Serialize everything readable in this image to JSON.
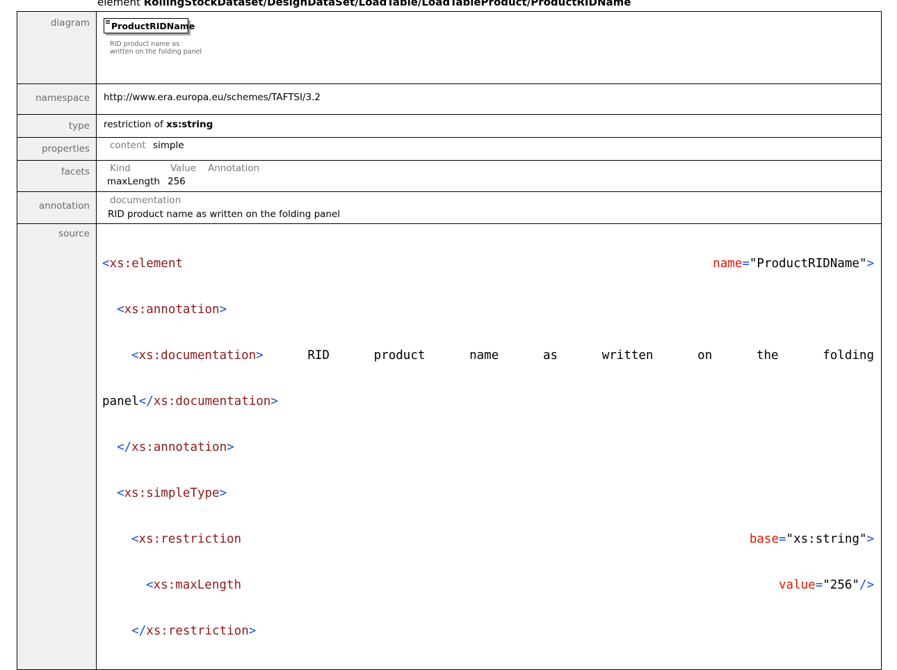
{
  "title": {
    "prefix": "element ",
    "path": "RollingStockDataset/DesignDataSet/LoadTable/LoadTableProduct/ProductRIDName"
  },
  "rows": {
    "diagram": {
      "label": "diagram",
      "element_name": "ProductRIDName",
      "doc_line1": "RID product name as",
      "doc_line2": "written on the folding panel"
    },
    "namespace": {
      "label": "namespace",
      "value": "http://www.era.europa.eu/schemes/TAFTSI/3.2"
    },
    "type": {
      "label": "type",
      "prefix": "restriction of ",
      "base": "xs:string"
    },
    "properties": {
      "label": "properties",
      "key": "content",
      "value": "simple"
    },
    "facets": {
      "label": "facets",
      "headers": [
        "Kind",
        "Value",
        "Annotation"
      ],
      "kind": "maxLength",
      "value": "256"
    },
    "annotation": {
      "label": "annotation",
      "header": "documentation",
      "text": "RID product name as written on the folding panel"
    },
    "source": {
      "label": "source",
      "element_open": "<xs:element",
      "name_attr": "name",
      "name_val": "\"ProductRIDName\"",
      "annotation_open": "<xs:annotation>",
      "documentation_open": "<xs:documentation>",
      "doc_words": [
        "RID",
        "product",
        "name",
        "as",
        "written",
        "on",
        "the",
        "folding"
      ],
      "doc_last": "panel",
      "documentation_close": "</xs:documentation>",
      "annotation_close": "</xs:annotation>",
      "simpletype_open": "<xs:simpleType>",
      "restriction_open": "<xs:restriction",
      "base_attr": "base",
      "base_val": "\"xs:string\"",
      "maxlength_open": "<xs:maxLength",
      "value_attr": "value",
      "value_val": "\"256\"",
      "restriction_close": "</xs:restriction>"
    }
  }
}
